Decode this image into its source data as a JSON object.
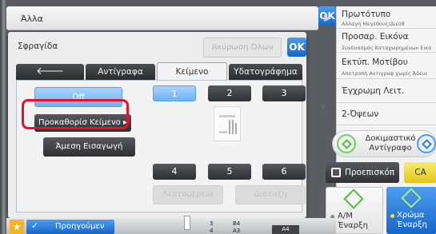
{
  "header": {
    "title": "Άλλα",
    "ok_label": "OK"
  },
  "dialog": {
    "title": "Σφραγίδα",
    "cancel_label": "Ακύρωση Όλων",
    "ok_label": "OK"
  },
  "tabs": [
    {
      "label": "Αντίγραφα"
    },
    {
      "label": "Κείμενο"
    },
    {
      "label": "Υδατογράφημα"
    }
  ],
  "active_tab": "Κείμενο",
  "left_buttons": {
    "off": "Off",
    "preset": "Προκαθορίσ Κείμενο",
    "direct": "Άμεση Εισαγωγή"
  },
  "positions": [
    "1",
    "2",
    "3",
    "4",
    "5",
    "6"
  ],
  "selected_position": "1",
  "bottom_buttons": {
    "details": "Λεπτομέρεια",
    "layout": "Διάταξη"
  },
  "right_panel": {
    "items": [
      {
        "main": "Πρωτότυπο",
        "sub": "Αλλαγή Μεγέθους/Διεύθ"
      },
      {
        "main": "Προσαρ. Εικόνα",
        "sub": "Συνδυασμός Καταχωρημένων Εικό"
      },
      {
        "main": "Εκτύπ. Μοτίβου",
        "sub": "Αποτροπή Αντιγραφ χωρίς Άδεια"
      },
      {
        "main": "Έγχρωμη Λειτ.",
        "sub": ""
      },
      {
        "main": "2-Όψεων",
        "sub": ""
      }
    ],
    "preview_label": "Δοκιμαστικό Αντίγραφο",
    "preview_btn": "Προεπισκόπ",
    "ca_label": "CA",
    "bw_line1": "Α/Μ",
    "bw_line2": "Έναρξη",
    "color_line1": "Χρώμα",
    "color_line2": "Έναρξη"
  },
  "footer": {
    "prev_label": "Προηγούμεν",
    "tray_nums": [
      "3",
      "4"
    ],
    "paper_sizes": [
      "B4",
      "A3",
      "A4"
    ]
  },
  "colors": {
    "accent": "#1566c7",
    "highlight": "#e8112d",
    "selected": "#6fb2f4",
    "green": "#4cc23c"
  }
}
